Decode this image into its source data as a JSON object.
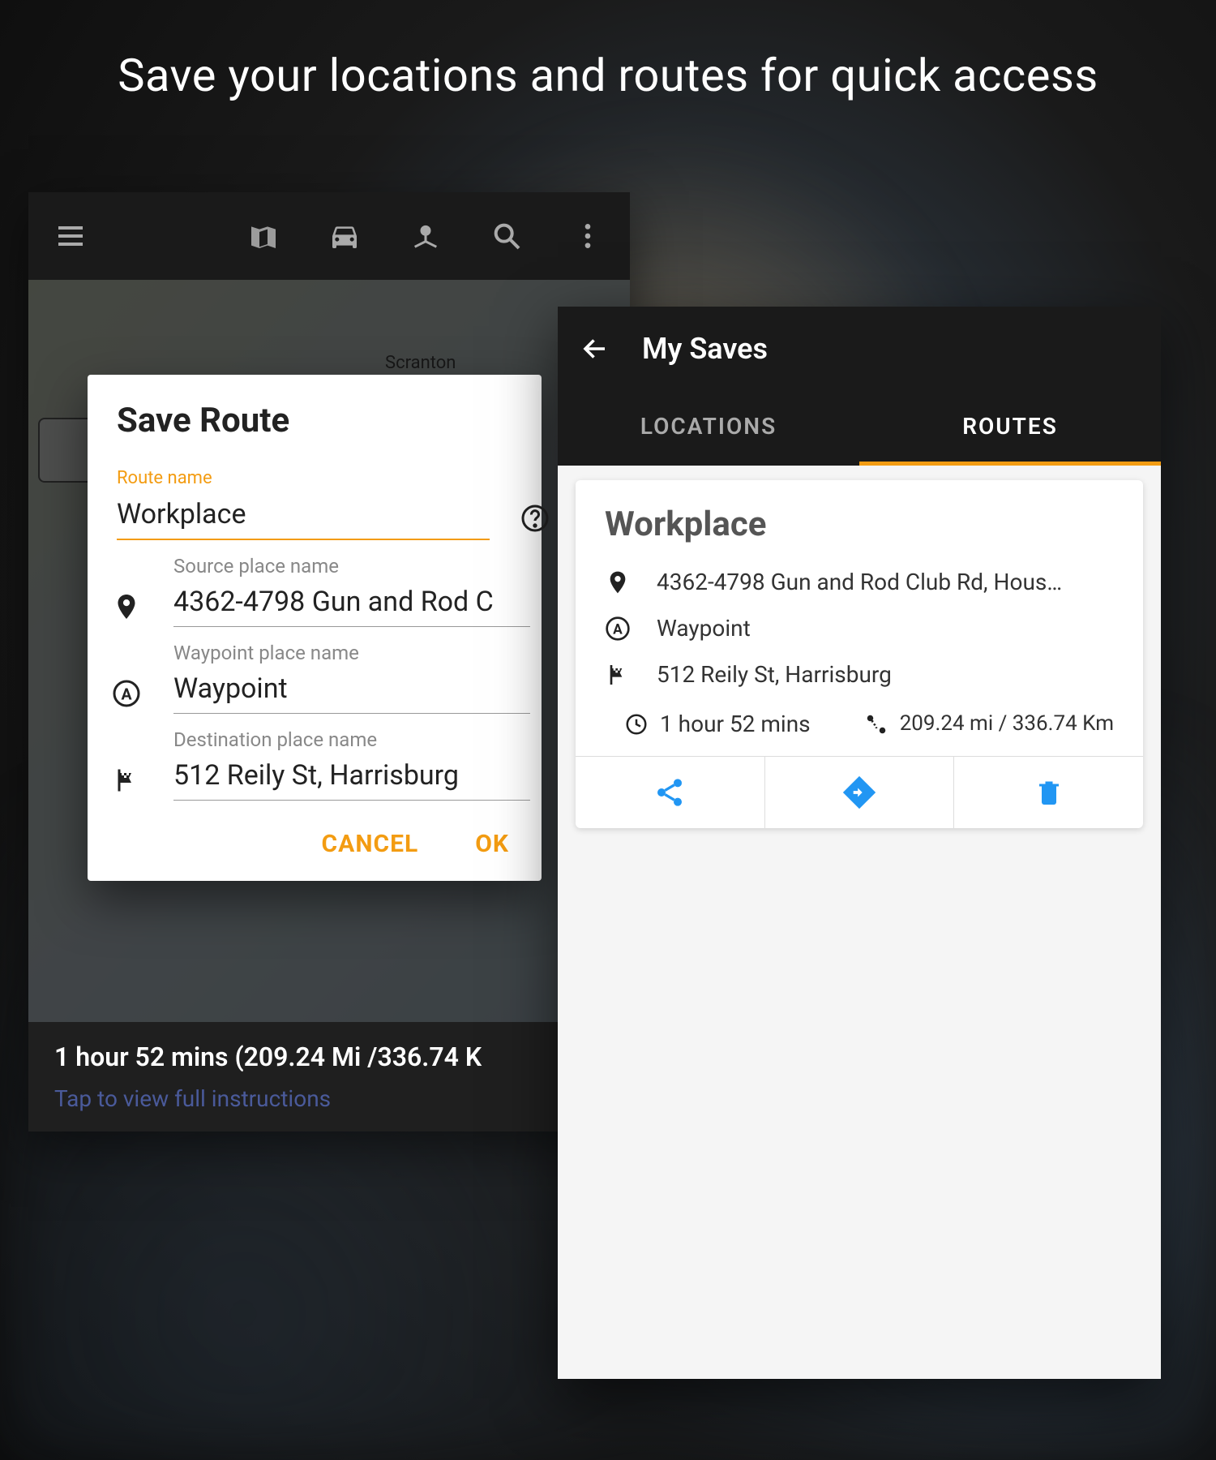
{
  "headline": "Save your locations and routes for quick access",
  "left": {
    "map_label": "Scranton",
    "dialog": {
      "title": "Save Route",
      "route_name_label": "Route name",
      "route_name_value": "Workplace",
      "source_label": "Source place name",
      "source_value": "4362-4798 Gun and Rod C",
      "waypoint_label": "Waypoint place name",
      "waypoint_value": "Waypoint",
      "destination_label": "Destination place name",
      "destination_value": "512 Reily St, Harrisburg",
      "cancel": "CANCEL",
      "ok": "OK"
    },
    "summary": "1 hour 52 mins  (209.24 Mi /336.74 K",
    "link": "Tap to view full instructions"
  },
  "right": {
    "title": "My Saves",
    "tabs": {
      "locations": "LOCATIONS",
      "routes": "ROUTES"
    },
    "card": {
      "title": "Workplace",
      "source": "4362-4798 Gun and Rod Club Rd, Hous…",
      "waypoint": "Waypoint",
      "destination": "512 Reily St, Harrisburg",
      "time": "1 hour 52 mins",
      "distance": "209.24 mi  / 336.74 Km"
    }
  }
}
